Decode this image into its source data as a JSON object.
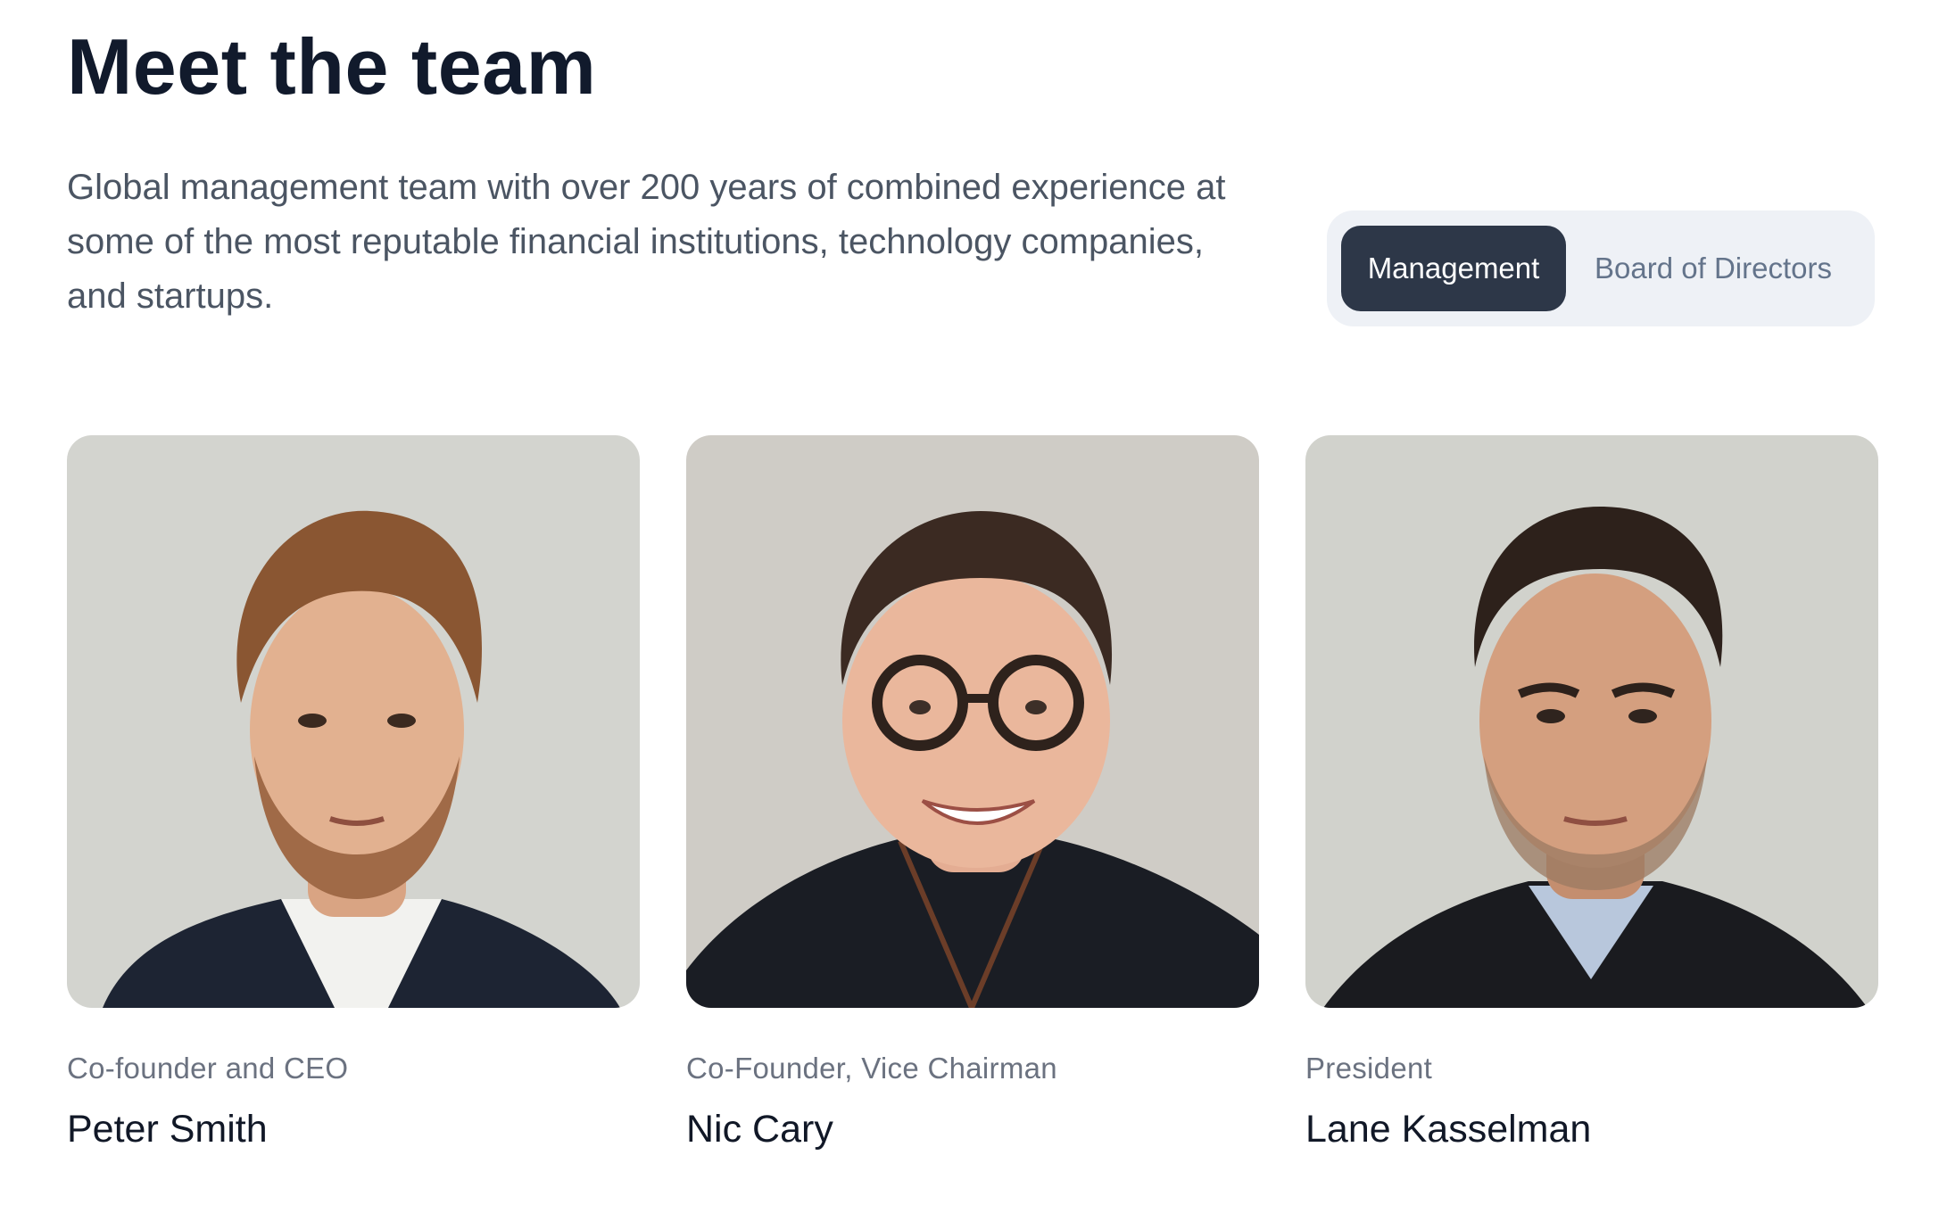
{
  "header": {
    "title": "Meet the team",
    "intro": "Global management team with over 200 years of combined experience at some of the most reputable financial institutions, technology companies, and startups."
  },
  "tabs": [
    {
      "label": "Management",
      "active": true
    },
    {
      "label": "Board of Directors",
      "active": false
    }
  ],
  "members": [
    {
      "role": "Co-founder and CEO",
      "name": "Peter Smith",
      "photo_bg": "#d3d4cf"
    },
    {
      "role": "Co-Founder, Vice Chairman",
      "name": "Nic Cary",
      "photo_bg": "#cfccc6"
    },
    {
      "role": "President",
      "name": "Lane Kasselman",
      "photo_bg": "#d1d2cc"
    }
  ],
  "colors": {
    "title": "#111a2c",
    "intro_text": "#4b5563",
    "tab_active_bg": "#2d3748",
    "tab_container_bg": "#eef1f6",
    "tab_inactive_text": "#64748b"
  }
}
